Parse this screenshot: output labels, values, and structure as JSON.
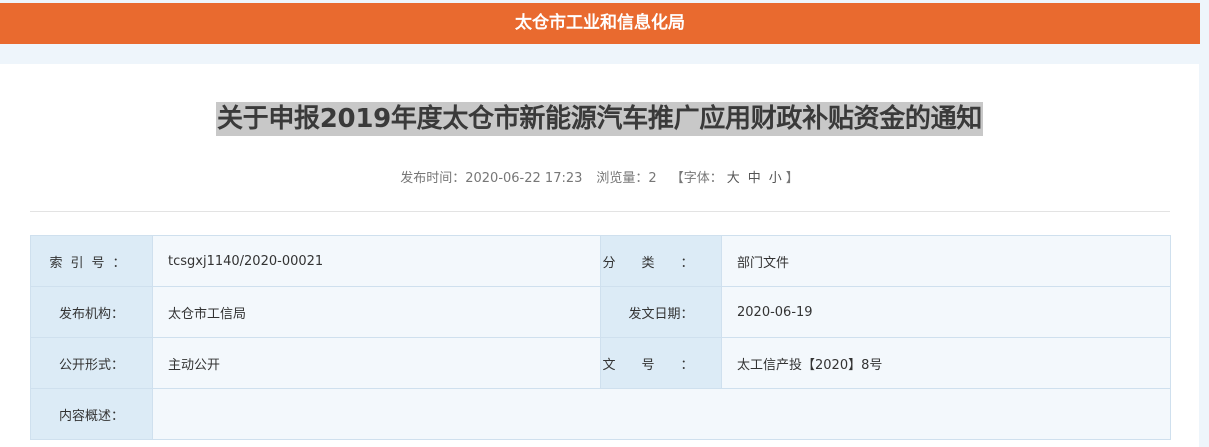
{
  "header": {
    "site_title": "太仓市工业和信息化局"
  },
  "article": {
    "title": "关于申报2019年度太仓市新能源汽车推广应用财政补贴资金的通知",
    "meta": {
      "publish_label": "发布时间：",
      "publish_time": "2020-06-22 17:23",
      "views_label": "浏览量：",
      "views": "2",
      "font_label": "【字体：",
      "font_large": "大",
      "font_medium": "中",
      "font_small": "小",
      "font_close": "】"
    }
  },
  "info_table": {
    "index_label": "索引号：",
    "index_value": "tcsgxj1140/2020-00021",
    "category_label": "分类：",
    "category_value": "部门文件",
    "publisher_label": "发布机构：",
    "publisher_value": "太仓市工信局",
    "date_label": "发文日期：",
    "date_value": "2020-06-19",
    "disclosure_label": "公开形式：",
    "disclosure_value": "主动公开",
    "docno_label": "文号：",
    "docno_value": "太工信产投【2020】8号",
    "summary_label": "内容概述：",
    "summary_value": ""
  },
  "colors": {
    "header_bg": "#e96a2f",
    "label_bg": "#dcebf6",
    "value_bg": "#f3f8fc",
    "title_highlight": "#c8c8c8"
  }
}
